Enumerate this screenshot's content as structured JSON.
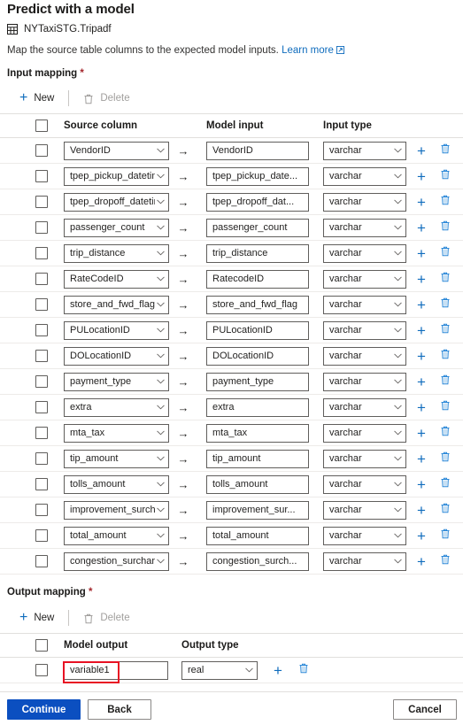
{
  "header": {
    "title": "Predict with a model",
    "table_icon": "table-icon",
    "table_name": "NYTaxiSTG.Tripadf",
    "description": "Map the source table columns to the expected model inputs.",
    "learn_more": "Learn more",
    "external_link_icon": "external-link-icon"
  },
  "input_mapping": {
    "label": "Input mapping",
    "required_marker": "*",
    "toolbar": {
      "new_label": "New",
      "new_icon": "plus-icon",
      "delete_label": "Delete",
      "delete_icon": "trash-icon",
      "delete_disabled": true
    },
    "columns": {
      "select_all": "select-all-checkbox",
      "source_column": "Source column",
      "model_input": "Model input",
      "input_type": "Input type"
    },
    "arrow_glyph": "→",
    "add_row_icon": "plus-icon",
    "delete_row_icon": "trash-icon",
    "rows": [
      {
        "source": "VendorID",
        "model": "VendorID",
        "type": "varchar"
      },
      {
        "source": "tpep_pickup_datetime",
        "model": "tpep_pickup_date...",
        "type": "varchar"
      },
      {
        "source": "tpep_dropoff_datetime",
        "model": "tpep_dropoff_dat...",
        "type": "varchar"
      },
      {
        "source": "passenger_count",
        "model": "passenger_count",
        "type": "varchar"
      },
      {
        "source": "trip_distance",
        "model": "trip_distance",
        "type": "varchar"
      },
      {
        "source": "RateCodeID",
        "model": "RatecodeID",
        "type": "varchar"
      },
      {
        "source": "store_and_fwd_flag",
        "model": "store_and_fwd_flag",
        "type": "varchar"
      },
      {
        "source": "PULocationID",
        "model": "PULocationID",
        "type": "varchar"
      },
      {
        "source": "DOLocationID",
        "model": "DOLocationID",
        "type": "varchar"
      },
      {
        "source": "payment_type",
        "model": "payment_type",
        "type": "varchar"
      },
      {
        "source": "extra",
        "model": "extra",
        "type": "varchar"
      },
      {
        "source": "mta_tax",
        "model": "mta_tax",
        "type": "varchar"
      },
      {
        "source": "tip_amount",
        "model": "tip_amount",
        "type": "varchar"
      },
      {
        "source": "tolls_amount",
        "model": "tolls_amount",
        "type": "varchar"
      },
      {
        "source": "improvement_surcharge",
        "model": "improvement_sur...",
        "type": "varchar"
      },
      {
        "source": "total_amount",
        "model": "total_amount",
        "type": "varchar"
      },
      {
        "source": "congestion_surcharge",
        "model": "congestion_surch...",
        "type": "varchar"
      }
    ]
  },
  "output_mapping": {
    "label": "Output mapping",
    "required_marker": "*",
    "toolbar": {
      "new_label": "New",
      "new_icon": "plus-icon",
      "delete_label": "Delete",
      "delete_icon": "trash-icon",
      "delete_disabled": true
    },
    "columns": {
      "select_all": "select-all-checkbox",
      "model_output": "Model output",
      "output_type": "Output type"
    },
    "add_row_icon": "plus-icon",
    "delete_row_icon": "trash-icon",
    "rows": [
      {
        "output": "variable1",
        "type": "real"
      }
    ],
    "highlight": {
      "target": "variable1",
      "color": "#e81123"
    }
  },
  "footer": {
    "continue_label": "Continue",
    "back_label": "Back",
    "cancel_label": "Cancel",
    "primary_color": "#0b4fc0"
  }
}
